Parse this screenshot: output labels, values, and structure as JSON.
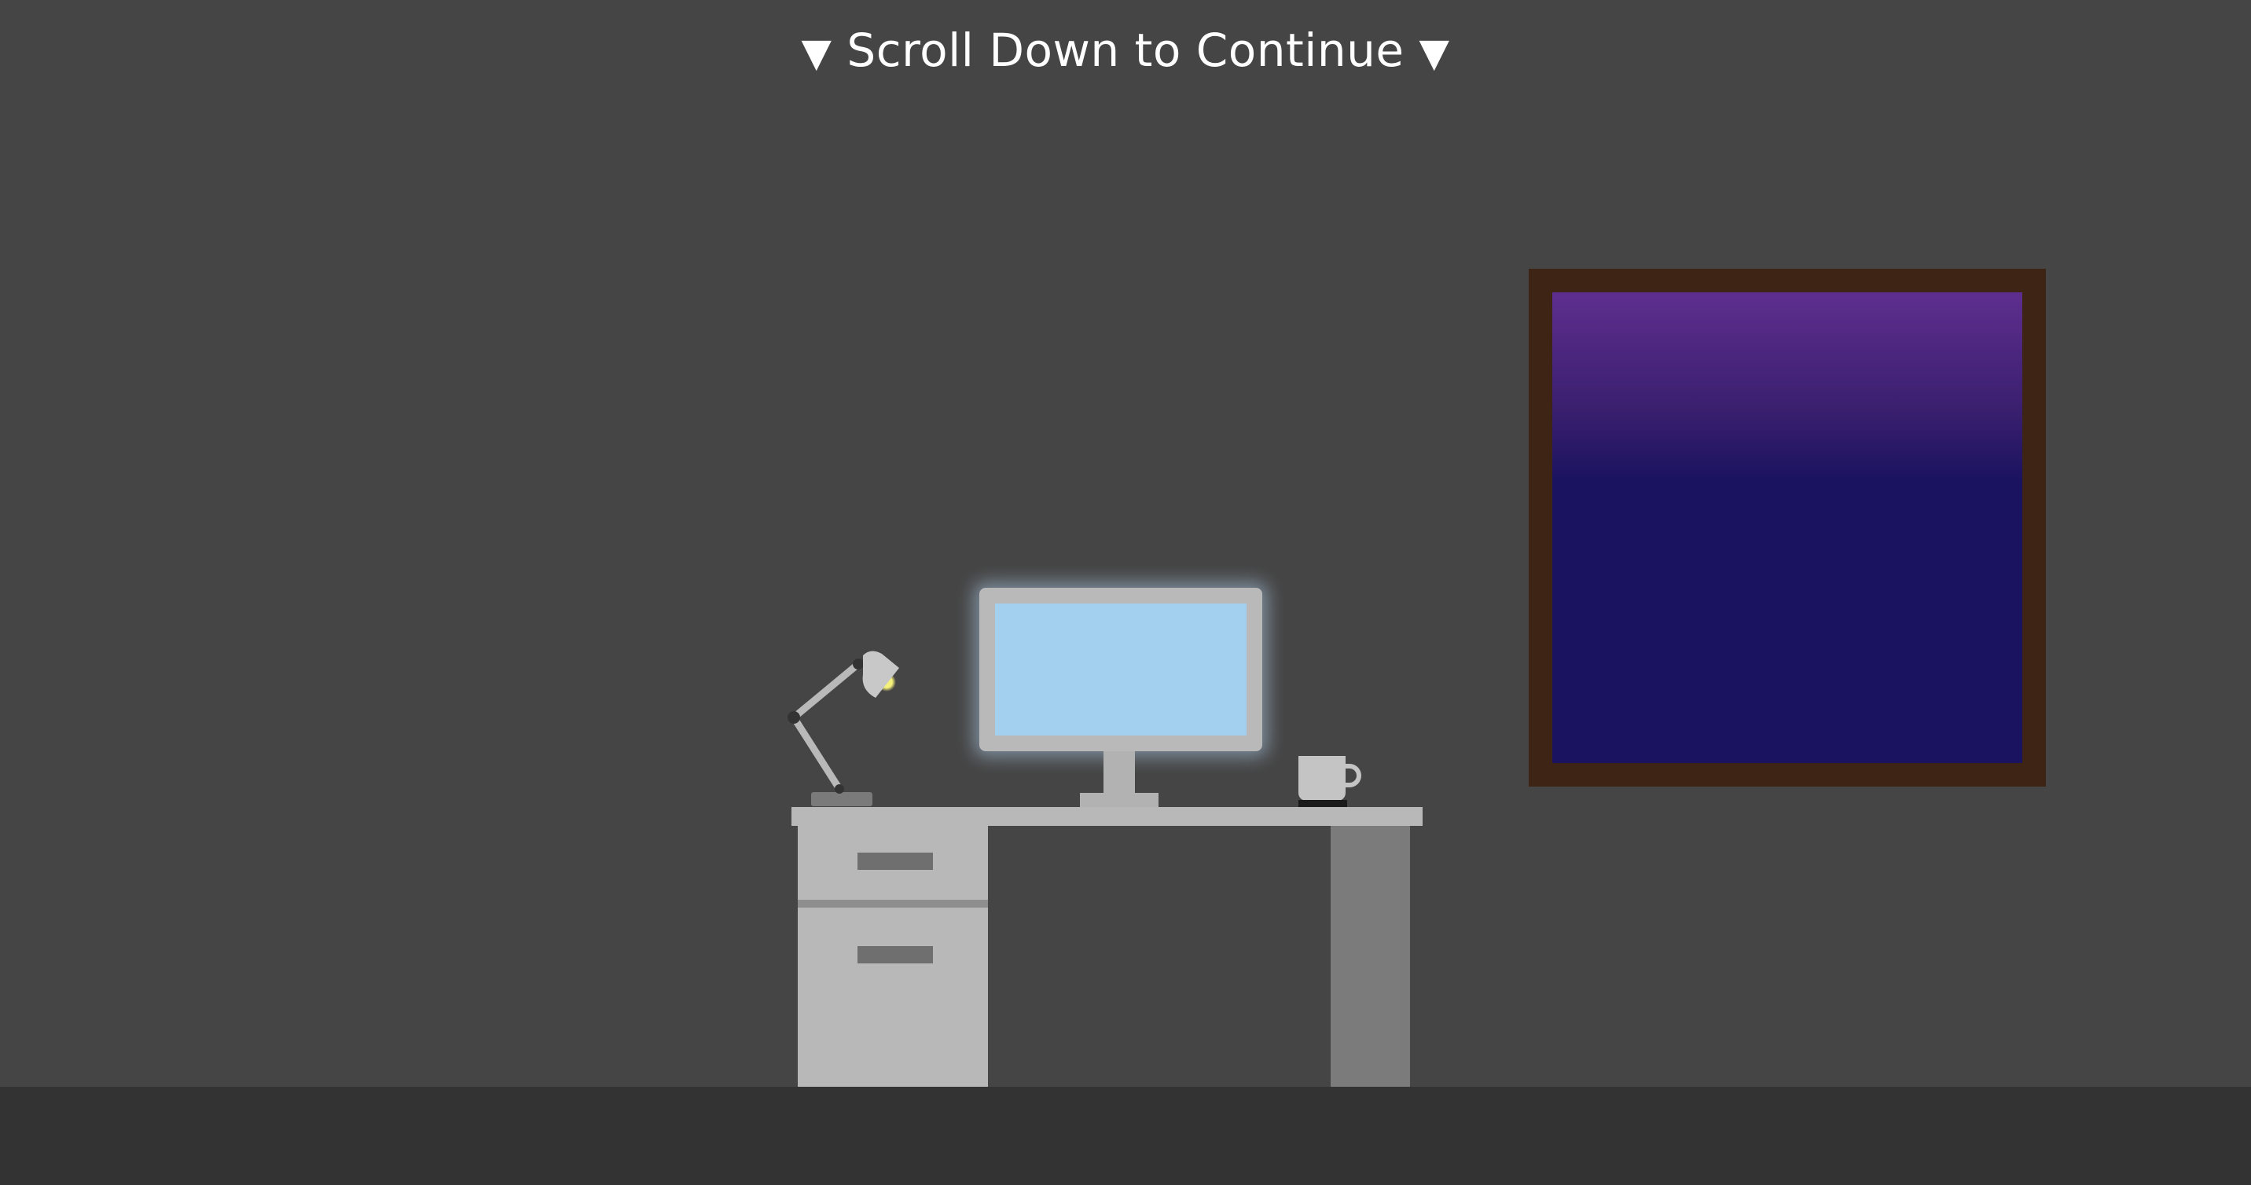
{
  "scroll_prompt": {
    "arrow_left": "▼",
    "text": "Scroll Down to Continue",
    "arrow_right": "▼"
  },
  "colors": {
    "wall": "#454545",
    "floor": "#333333",
    "window_frame": "#3e2415",
    "sky_top": "#5e2e8e",
    "sky_bottom": "#1a135f",
    "monitor_screen": "#a2d0ee",
    "desk": "#b8b8b8",
    "lamp_bulb": "#f5f07a"
  }
}
